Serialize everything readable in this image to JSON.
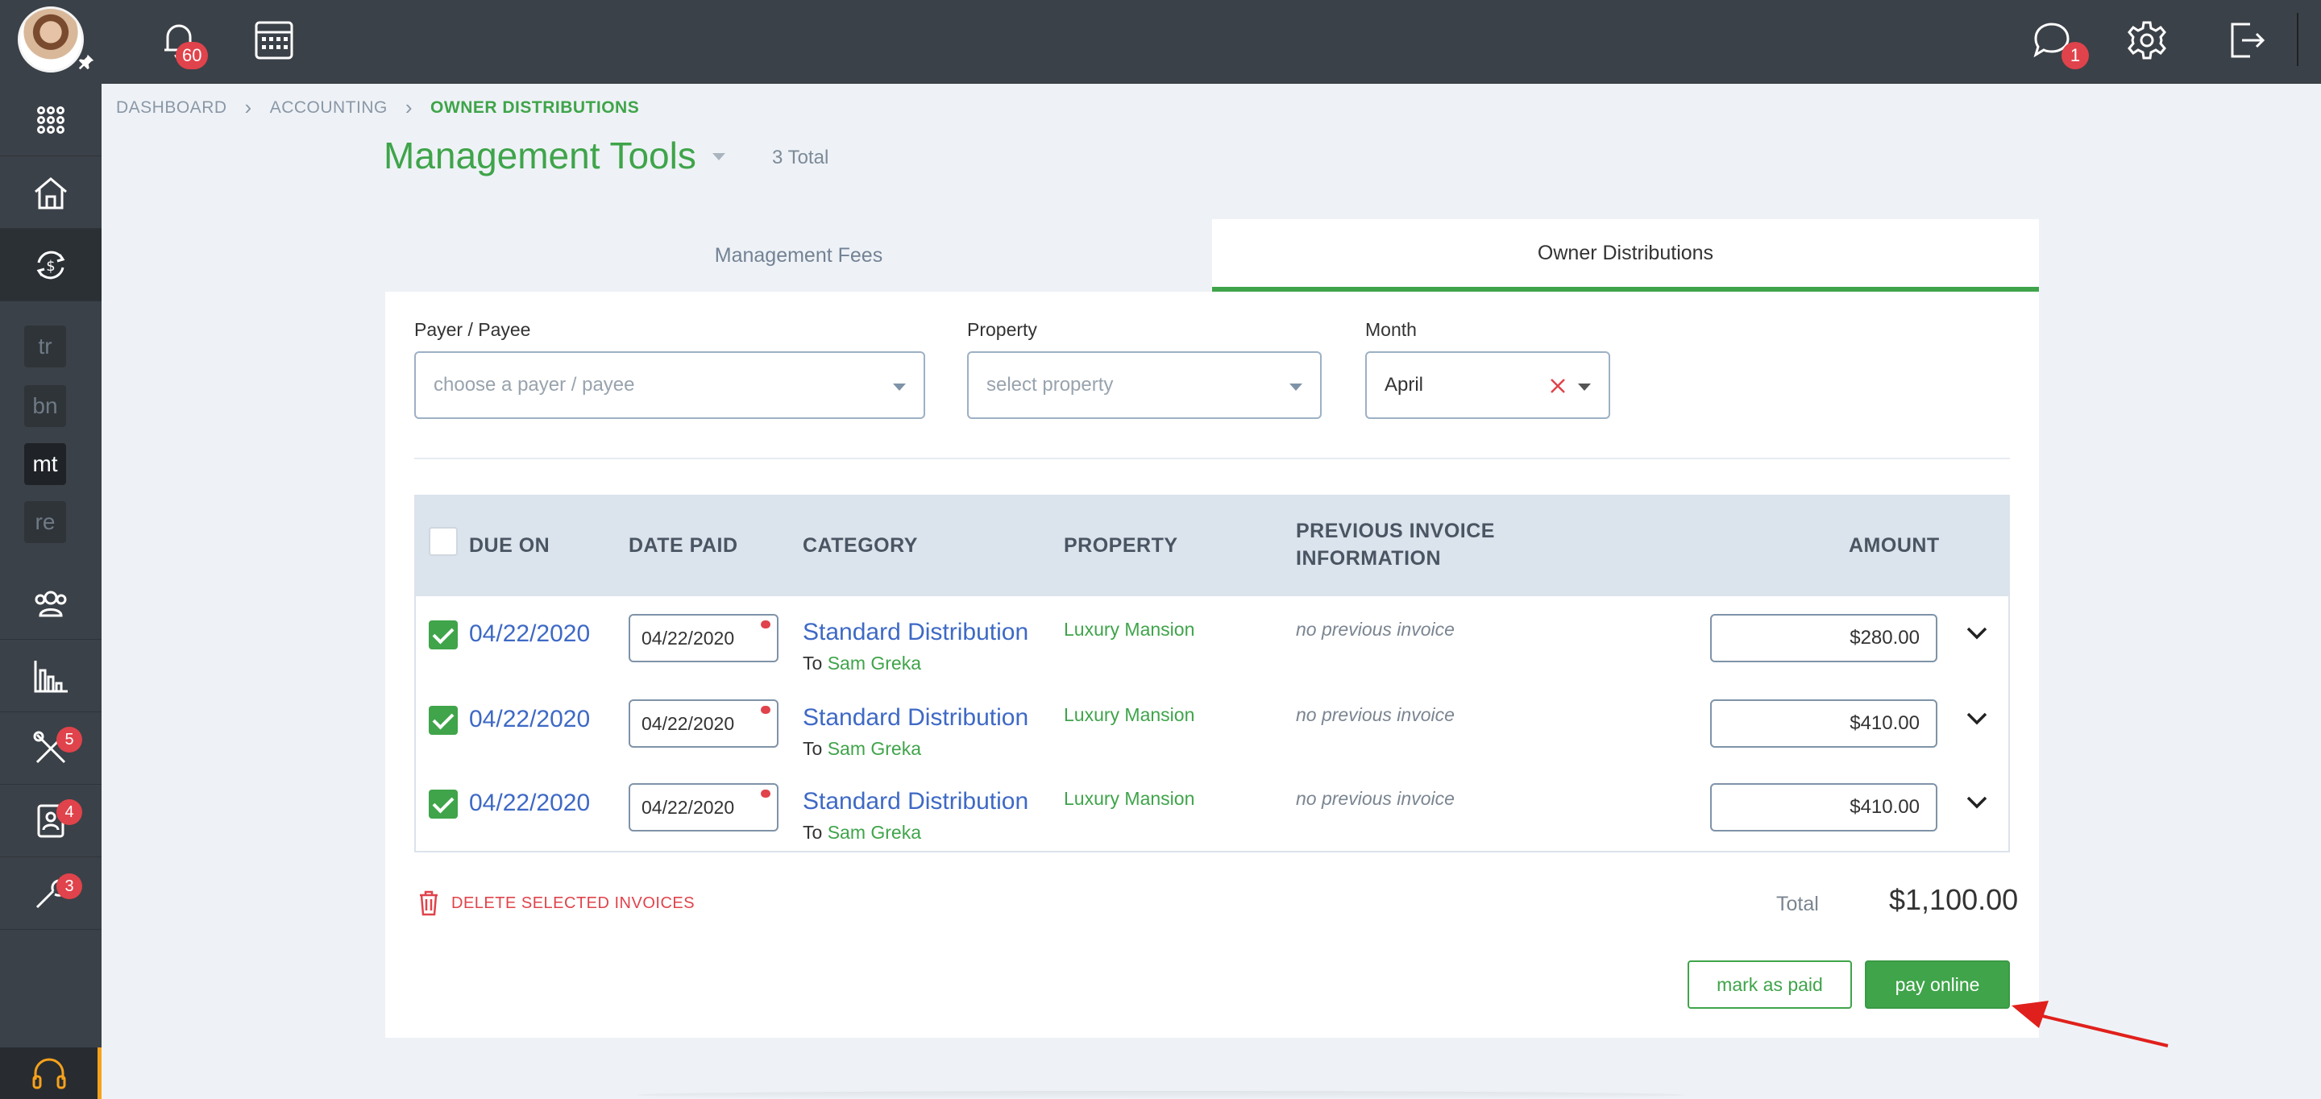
{
  "header": {
    "notifications_count": "60",
    "messages_count": "1"
  },
  "sidebar": {
    "codes": [
      "tr",
      "bn",
      "mt",
      "re"
    ],
    "badges": {
      "tools": "5",
      "contacts": "4",
      "maintenance": "3"
    }
  },
  "breadcrumb": [
    "DASHBOARD",
    "ACCOUNTING",
    "OWNER DISTRIBUTIONS"
  ],
  "page": {
    "title": "Management Tools",
    "total_count": "3 Total"
  },
  "tabs": [
    {
      "label": "Management Fees",
      "active": false
    },
    {
      "label": "Owner Distributions",
      "active": true
    }
  ],
  "filters": {
    "payer": {
      "label": "Payer / Payee",
      "placeholder": "choose a payer / payee"
    },
    "property": {
      "label": "Property",
      "placeholder": "select property"
    },
    "month": {
      "label": "Month",
      "value": "April"
    }
  },
  "table": {
    "columns": {
      "due_on": "DUE ON",
      "date_paid": "DATE PAID",
      "category": "CATEGORY",
      "property": "PROPERTY",
      "previous_line1": "PREVIOUS INVOICE",
      "previous_line2": "INFORMATION",
      "amount": "AMOUNT"
    },
    "rows": [
      {
        "due_on": "04/22/2020",
        "date_paid": "04/22/2020",
        "category": "Standard Distribution",
        "to_prefix": "To",
        "payee": "Sam Greka",
        "property": "Luxury Mansion",
        "previous": "no previous invoice",
        "amount": "$280.00"
      },
      {
        "due_on": "04/22/2020",
        "date_paid": "04/22/2020",
        "category": "Standard Distribution",
        "to_prefix": "To",
        "payee": "Sam Greka",
        "property": "Luxury Mansion",
        "previous": "no previous invoice",
        "amount": "$410.00"
      },
      {
        "due_on": "04/22/2020",
        "date_paid": "04/22/2020",
        "category": "Standard Distribution",
        "to_prefix": "To",
        "payee": "Sam Greka",
        "property": "Luxury Mansion",
        "previous": "no previous invoice",
        "amount": "$410.00"
      }
    ]
  },
  "footer": {
    "delete_label": "DELETE SELECTED INVOICES",
    "total_label": "Total",
    "total_value": "$1,100.00",
    "mark_paid_label": "mark as paid",
    "pay_online_label": "pay online"
  },
  "colors": {
    "accent": "#3fa44a",
    "link": "#3e69c5",
    "danger": "#e0434b",
    "sidebar": "#3b4148"
  }
}
